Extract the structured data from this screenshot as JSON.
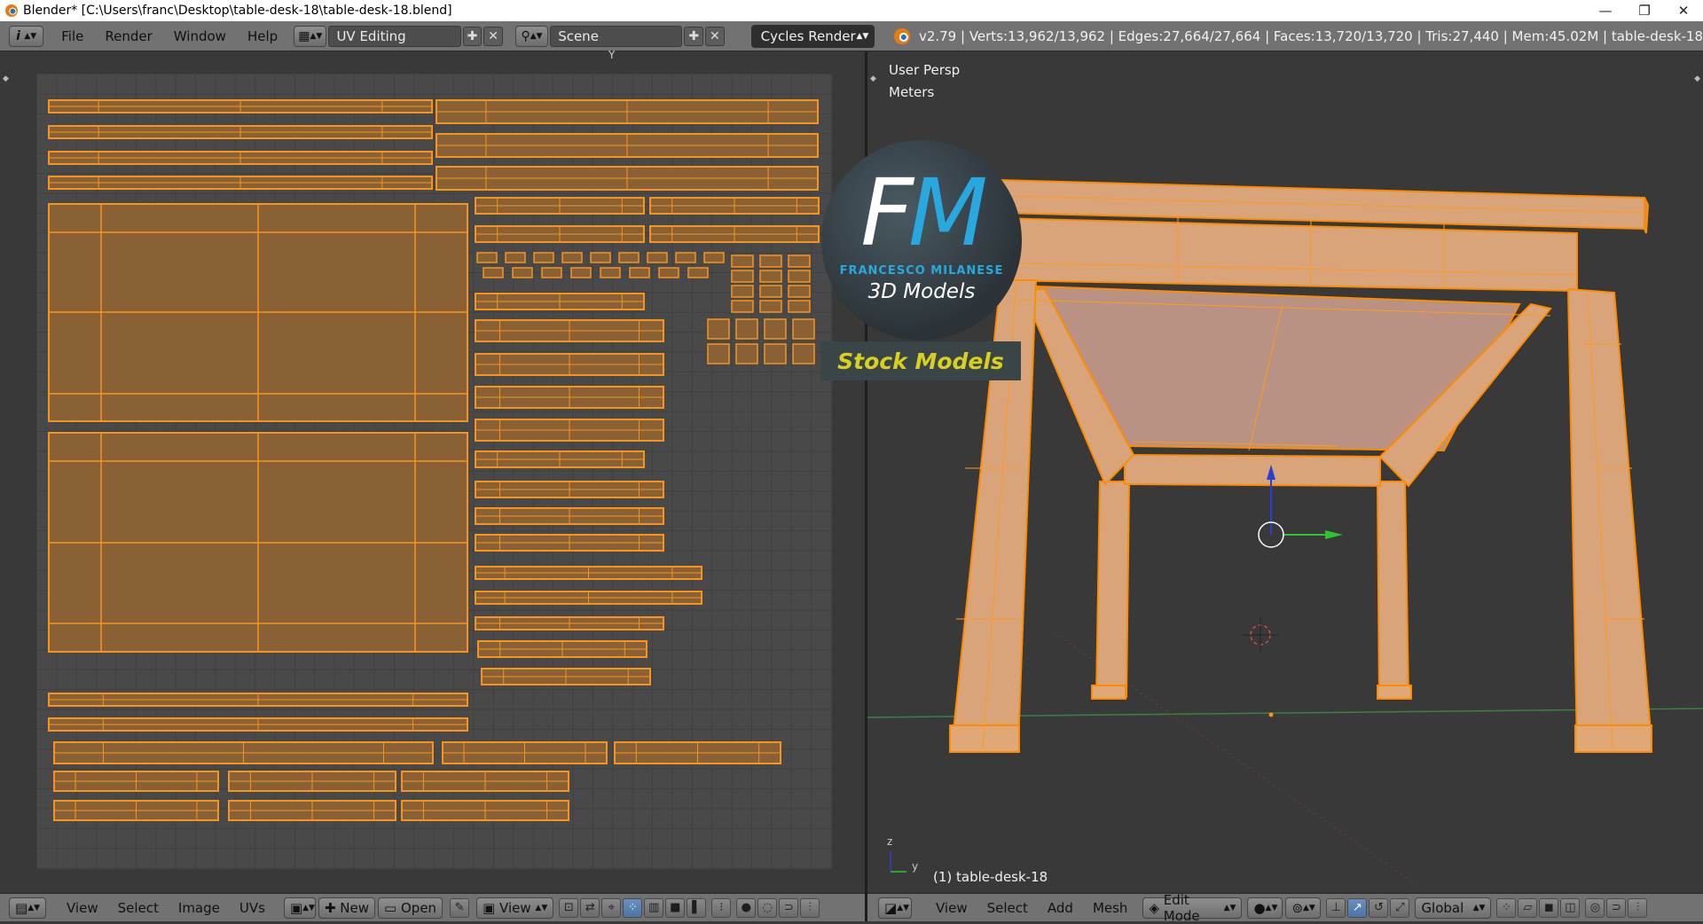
{
  "window": {
    "title": "Blender* [C:\\Users\\franc\\Desktop\\table-desk-18\\table-desk-18.blend]",
    "controls": [
      "—",
      "❐",
      "✕"
    ]
  },
  "info_header": {
    "editor_icon": "i",
    "menus": [
      "File",
      "Render",
      "Window",
      "Help"
    ],
    "screen_layout": "UV Editing",
    "scene": "Scene",
    "render_engine": "Cycles Render",
    "stats": "v2.79 | Verts:13,962/13,962 | Edges:27,664/27,664 | Faces:13,720/13,720 | Tris:27,440 | Mem:45.02M | table-desk-18"
  },
  "viewport": {
    "view_name": "User Persp",
    "units": "Meters",
    "object_label": "(1) table-desk-18",
    "axis_z": "z",
    "axis_y": "y"
  },
  "watermark": {
    "letter_f": "F",
    "letter_m": "M",
    "author": "FRANCESCO MILANESE",
    "subtitle": "3D Models",
    "banner": "Stock Models"
  },
  "uv_footer": {
    "menus": [
      "View",
      "Select",
      "Image",
      "UVs"
    ],
    "new_label": "New",
    "open_label": "Open",
    "view_label": "View"
  },
  "view3d_footer": {
    "menus": [
      "View",
      "Select",
      "Add",
      "Mesh"
    ],
    "mode": "Edit Mode",
    "orientation": "Global"
  },
  "colors": {
    "uv_edge": "#f7941d",
    "uv_fill": "#8a6134",
    "mesh_fill": "#d9a47a",
    "header": "#727272"
  }
}
